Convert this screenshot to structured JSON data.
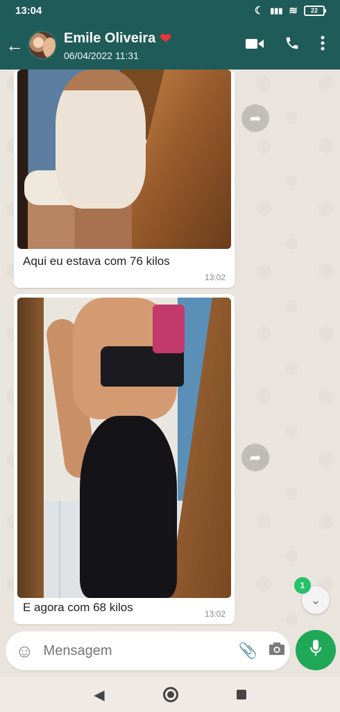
{
  "status_bar": {
    "time": "13:04",
    "icons": [
      "moon-icon",
      "signal-icon",
      "wifi-icon",
      "battery-icon"
    ],
    "battery": "22"
  },
  "header": {
    "back_icon": "arrow-left-icon",
    "contact_name": "Emile Oliveira",
    "heart": "❤",
    "subtitle": "06/04/2022 11:31",
    "actions": [
      "video-call-icon",
      "phone-icon",
      "more-vert-icon"
    ]
  },
  "messages": [
    {
      "type": "image",
      "caption": "Aqui eu estava com 76 kilos",
      "time": "13:02"
    },
    {
      "type": "image",
      "caption": "E agora com 68 kilos",
      "time": "13:02"
    }
  ],
  "scroll_down": {
    "unread_count": "1",
    "icon": "chevrons-down-icon"
  },
  "input": {
    "placeholder": "Mensagem"
  },
  "colors": {
    "header": "#1f5b59",
    "mic": "#1fa855",
    "badge": "#25c26a",
    "chat_bg": "#e9e4dd"
  }
}
